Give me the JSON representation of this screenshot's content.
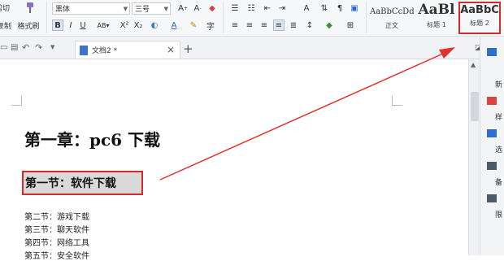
{
  "ribbon": {
    "cut_label": "剪切",
    "copy_label": "复制",
    "format_painter_label": "格式刷",
    "font_name": "黑体",
    "font_size": "三号",
    "styles": [
      {
        "preview": "AaBbCcDd",
        "name": "正文"
      },
      {
        "preview": "AaBl",
        "name": "标题 1"
      },
      {
        "preview": "AaBbC",
        "name": "标题 2"
      }
    ],
    "highlight_color": "#d32b2b"
  },
  "tabbar": {
    "doc_tab_label": "文档2 *",
    "close_glyph": "×",
    "add_glyph": "+"
  },
  "document": {
    "chapter_heading": "第一章：pc6 下载",
    "section_heading": "第一节：软件下载",
    "lines": [
      "第二节：游戏下载",
      "第三节：聊天软件",
      "第四节：网络工具",
      "第五节：安全软件"
    ]
  },
  "right_panel": {
    "items": [
      "新",
      "样",
      "选",
      "备",
      "限"
    ]
  }
}
